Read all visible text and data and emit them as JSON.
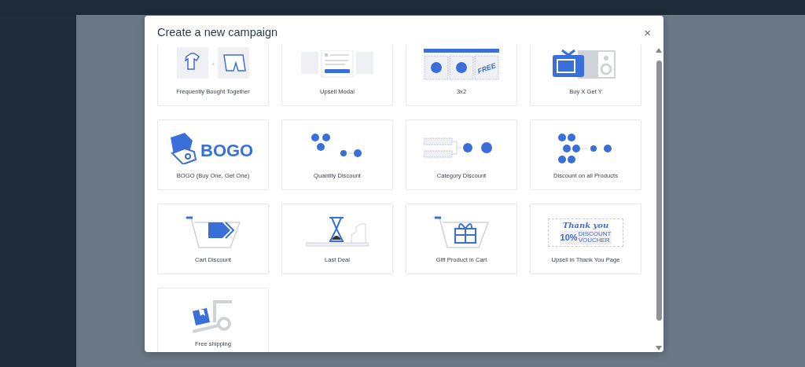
{
  "modal": {
    "title": "Create a new campaign",
    "close_label": "×",
    "campaigns": [
      {
        "kind": "bundle",
        "label": "Frequently Bought Together",
        "art_text": [
          "+"
        ]
      },
      {
        "kind": "upsell_modal",
        "label": "Upsell Modal"
      },
      {
        "kind": "three_for_two",
        "label": "3x2",
        "art_text": [
          "FREE"
        ]
      },
      {
        "kind": "buy_x_get_y",
        "label": "Buy X Get Y"
      },
      {
        "kind": "bogo",
        "label": "BOGO (Buy One, Get One)",
        "art_text": [
          "BOGO"
        ]
      },
      {
        "kind": "quantity",
        "label": "Quantity Discount"
      },
      {
        "kind": "category",
        "label": "Category Discount"
      },
      {
        "kind": "all_products",
        "label": "Discount on all Products"
      },
      {
        "kind": "cart_discount",
        "label": "Cart Discount"
      },
      {
        "kind": "last_deal",
        "label": "Last Deal"
      },
      {
        "kind": "gift",
        "label": "Gift Product in Cart"
      },
      {
        "kind": "thank_you",
        "label": "Upsell in Thank You Page",
        "art_text": [
          "Thank you",
          "10%",
          "DISCOUNT",
          "VOUCHER"
        ]
      },
      {
        "kind": "free_shipping",
        "label": "Free shipping"
      }
    ]
  }
}
